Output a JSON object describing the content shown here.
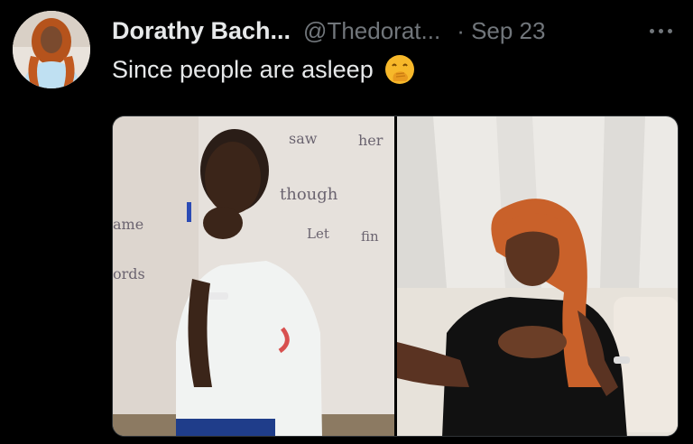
{
  "tweet": {
    "author_name": "Dorathy Bach...",
    "author_handle": "@Thedorat...",
    "timestamp": "· Sep 23",
    "text": "Since people are asleep",
    "emoji": "face-with-hand-over-mouth",
    "board_words": [
      "saw",
      "her",
      "though",
      "Let",
      "fin",
      "ame",
      "ords"
    ]
  },
  "icons": {
    "avatar": "profile-avatar",
    "more": "more-horizontal-icon"
  },
  "colors": {
    "background": "#000000",
    "primary_text": "#e7e9ea",
    "secondary_text": "#71767b",
    "emoji_yellow": "#f7b82a"
  }
}
